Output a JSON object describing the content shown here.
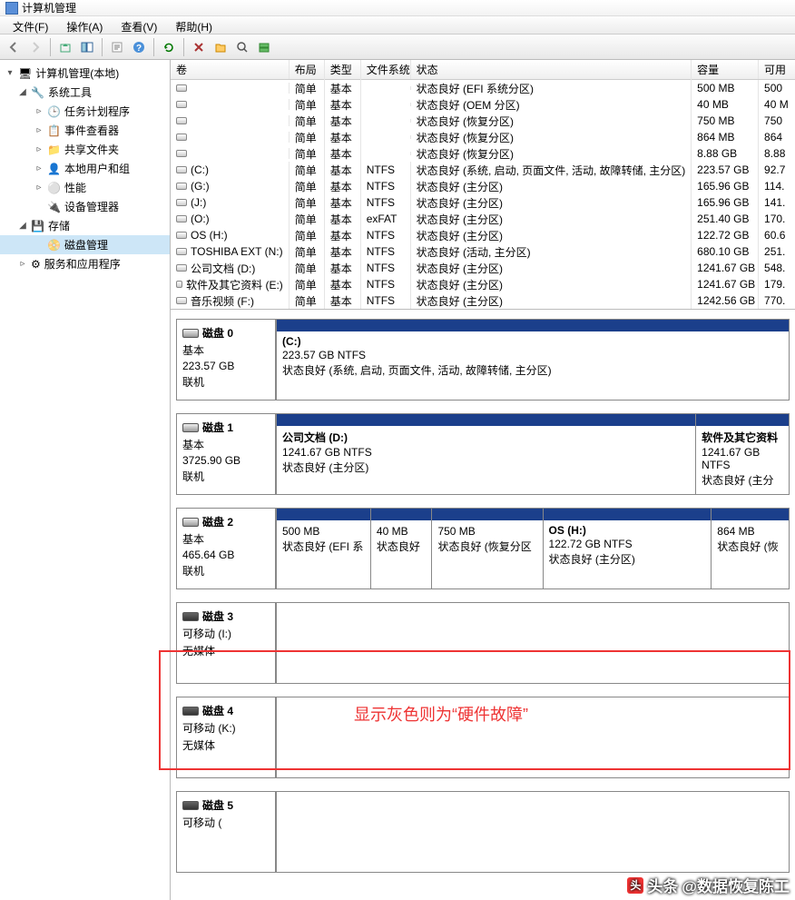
{
  "window": {
    "title": "计算机管理"
  },
  "menu": {
    "file": "文件(F)",
    "action": "操作(A)",
    "view": "查看(V)",
    "help": "帮助(H)"
  },
  "tree": {
    "root": "计算机管理(本地)",
    "sys_tools": "系统工具",
    "task_scheduler": "任务计划程序",
    "event_viewer": "事件查看器",
    "shared_folders": "共享文件夹",
    "local_users": "本地用户和组",
    "performance": "性能",
    "device_manager": "设备管理器",
    "storage": "存储",
    "disk_management": "磁盘管理",
    "services_apps": "服务和应用程序"
  },
  "columns": {
    "volume": "卷",
    "layout": "布局",
    "type": "类型",
    "fs": "文件系统",
    "status": "状态",
    "capacity": "容量",
    "available": "可用"
  },
  "volumes": [
    {
      "name": "",
      "layout": "简单",
      "type": "基本",
      "fs": "",
      "status": "状态良好 (EFI 系统分区)",
      "cap": "500 MB",
      "avail": "500"
    },
    {
      "name": "",
      "layout": "简单",
      "type": "基本",
      "fs": "",
      "status": "状态良好 (OEM 分区)",
      "cap": "40 MB",
      "avail": "40 M"
    },
    {
      "name": "",
      "layout": "简单",
      "type": "基本",
      "fs": "",
      "status": "状态良好 (恢复分区)",
      "cap": "750 MB",
      "avail": "750"
    },
    {
      "name": "",
      "layout": "简单",
      "type": "基本",
      "fs": "",
      "status": "状态良好 (恢复分区)",
      "cap": "864 MB",
      "avail": "864"
    },
    {
      "name": "",
      "layout": "简单",
      "type": "基本",
      "fs": "",
      "status": "状态良好 (恢复分区)",
      "cap": "8.88 GB",
      "avail": "8.88"
    },
    {
      "name": "(C:)",
      "layout": "简单",
      "type": "基本",
      "fs": "NTFS",
      "status": "状态良好 (系统, 启动, 页面文件, 活动, 故障转储, 主分区)",
      "cap": "223.57 GB",
      "avail": "92.7"
    },
    {
      "name": "(G:)",
      "layout": "简单",
      "type": "基本",
      "fs": "NTFS",
      "status": "状态良好 (主分区)",
      "cap": "165.96 GB",
      "avail": "114."
    },
    {
      "name": "(J:)",
      "layout": "简单",
      "type": "基本",
      "fs": "NTFS",
      "status": "状态良好 (主分区)",
      "cap": "165.96 GB",
      "avail": "141."
    },
    {
      "name": "(O:)",
      "layout": "简单",
      "type": "基本",
      "fs": "exFAT",
      "status": "状态良好 (主分区)",
      "cap": "251.40 GB",
      "avail": "170."
    },
    {
      "name": "OS (H:)",
      "layout": "简单",
      "type": "基本",
      "fs": "NTFS",
      "status": "状态良好 (主分区)",
      "cap": "122.72 GB",
      "avail": "60.6"
    },
    {
      "name": "TOSHIBA EXT (N:)",
      "layout": "简单",
      "type": "基本",
      "fs": "NTFS",
      "status": "状态良好 (活动, 主分区)",
      "cap": "680.10 GB",
      "avail": "251."
    },
    {
      "name": "公司文档 (D:)",
      "layout": "简单",
      "type": "基本",
      "fs": "NTFS",
      "status": "状态良好 (主分区)",
      "cap": "1241.67 GB",
      "avail": "548."
    },
    {
      "name": "软件及其它资料 (E:)",
      "layout": "简单",
      "type": "基本",
      "fs": "NTFS",
      "status": "状态良好 (主分区)",
      "cap": "1241.67 GB",
      "avail": "179."
    },
    {
      "name": "音乐视频 (F:)",
      "layout": "简单",
      "type": "基本",
      "fs": "NTFS",
      "status": "状态良好 (主分区)",
      "cap": "1242.56 GB",
      "avail": "770."
    }
  ],
  "disks": [
    {
      "name": "磁盘 0",
      "type": "基本",
      "size": "223.57 GB",
      "status": "联机",
      "parts": [
        {
          "name": "(C:)",
          "info": "223.57 GB NTFS",
          "status": "状态良好 (系统, 启动, 页面文件, 活动, 故障转储, 主分区)",
          "flex": 1
        }
      ]
    },
    {
      "name": "磁盘 1",
      "type": "基本",
      "size": "3725.90 GB",
      "status": "联机",
      "parts": [
        {
          "name": "公司文档  (D:)",
          "info": "1241.67 GB NTFS",
          "status": "状态良好 (主分区)",
          "flex": 5
        },
        {
          "name": "软件及其它资料",
          "info": "1241.67 GB NTFS",
          "status": "状态良好 (主分",
          "flex": 1
        }
      ]
    },
    {
      "name": "磁盘 2",
      "type": "基本",
      "size": "465.64 GB",
      "status": "联机",
      "parts": [
        {
          "name": "",
          "info": "500 MB",
          "status": "状态良好 (EFI 系",
          "flex": 10
        },
        {
          "name": "",
          "info": "40 MB",
          "status": "状态良好",
          "flex": 6
        },
        {
          "name": "",
          "info": "750 MB",
          "status": "状态良好 (恢复分区",
          "flex": 12
        },
        {
          "name": "OS  (H:)",
          "info": "122.72 GB NTFS",
          "status": "状态良好 (主分区)",
          "flex": 19
        },
        {
          "name": "",
          "info": "864 MB",
          "status": "状态良好 (恢",
          "flex": 8
        }
      ]
    },
    {
      "name": "磁盘 3",
      "type": "可移动 (I:)",
      "size": "",
      "status": "无媒体",
      "removable": true,
      "parts": [
        {
          "name": "",
          "info": "",
          "status": "",
          "flex": 1,
          "nostripe": true
        }
      ]
    },
    {
      "name": "磁盘 4",
      "type": "可移动 (K:)",
      "size": "",
      "status": "无媒体",
      "removable": true,
      "parts": [
        {
          "name": "",
          "info": "",
          "status": "",
          "flex": 1,
          "nostripe": true
        }
      ]
    },
    {
      "name": "磁盘 5",
      "type": "可移动 (",
      "size": "",
      "status": "",
      "removable": true,
      "parts": [
        {
          "name": "",
          "info": "",
          "status": "",
          "flex": 1,
          "nostripe": true
        }
      ]
    }
  ],
  "annotation": {
    "text": "显示灰色则为“硬件故障”"
  },
  "watermark": {
    "prefix": "头条",
    "text": "@数据恢复陈工"
  }
}
